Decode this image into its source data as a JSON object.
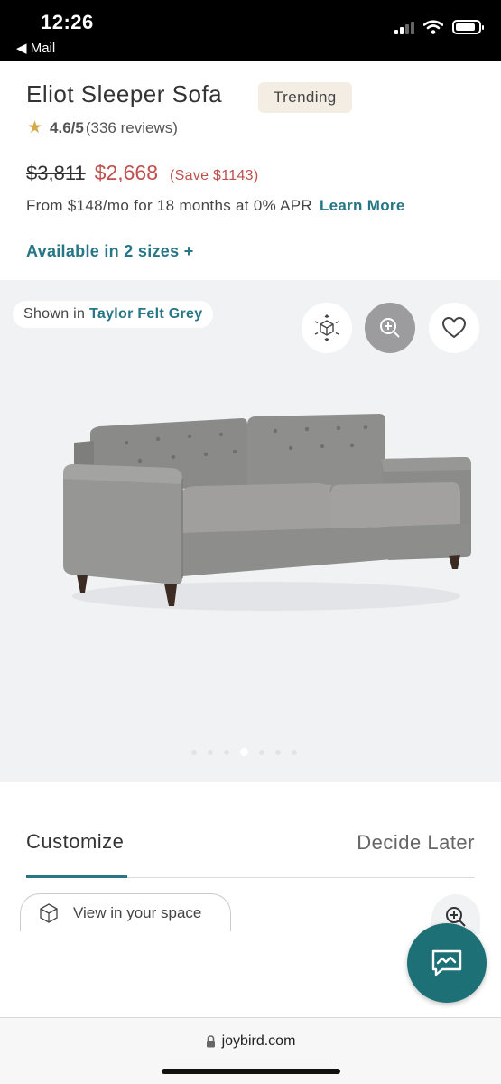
{
  "status_bar": {
    "time": "12:26",
    "back_label": "◀ Mail",
    "signal_bars": 4,
    "signal_bars_filled": 2,
    "battery_level": 0.75
  },
  "product": {
    "title": "Eliot Sleeper Sofa",
    "badge": "Trending",
    "rating": "4.6/5",
    "reviews": "(336 reviews)",
    "star_icon": "★",
    "old_price": "$3,811",
    "new_price": "$2,668",
    "save_text": "(Save $1143)",
    "finance_text": "From $148/mo for 18 months at 0% APR",
    "finance_link": "Learn More",
    "sizes_link": "Available in 2 sizes +"
  },
  "image_area": {
    "shown_in_label": "Shown in",
    "color_name": "Taylor Felt Grey",
    "buttons": [
      "ar-cube-icon",
      "zoom-in-icon",
      "heart-icon"
    ],
    "dots_count": 7,
    "active_dot": 3
  },
  "tabs": {
    "customize": "Customize",
    "decide_later": "Decide Later"
  },
  "view_space": {
    "label": "View in your space"
  },
  "browser": {
    "url": "joybird.com"
  },
  "colors": {
    "accent_teal": "#267686",
    "price_red": "#c0504d",
    "badge_bg": "#f3ede4",
    "chat_fab": "#1e7077"
  }
}
